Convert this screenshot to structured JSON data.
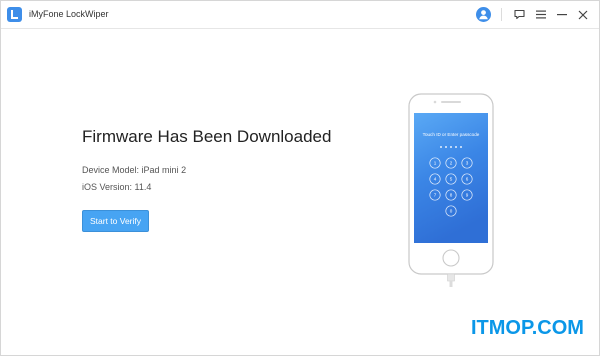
{
  "app": {
    "title": "iMyFone LockWiper",
    "brand_color": "#3e8ee9"
  },
  "titlebar": {
    "icons": [
      "user-avatar-icon",
      "feedback-icon",
      "menu-icon",
      "minimize-icon",
      "close-icon"
    ]
  },
  "main": {
    "heading": "Firmware Has Been Downloaded",
    "device_model_label": "Device Model:",
    "device_model_value": "iPad mini 2",
    "ios_version_label": "iOS Version:",
    "ios_version_value": "11.4",
    "verify_button_label": "Start to Verify",
    "accent_color": "#47a4f3"
  },
  "phone": {
    "lock_prompt": "Touch ID or Enter passcode",
    "keys": [
      "1",
      "2",
      "3",
      "4",
      "5",
      "6",
      "7",
      "8",
      "9",
      "0"
    ]
  },
  "watermark": {
    "text": "ITMOP.COM",
    "color": "#0b97e8"
  }
}
